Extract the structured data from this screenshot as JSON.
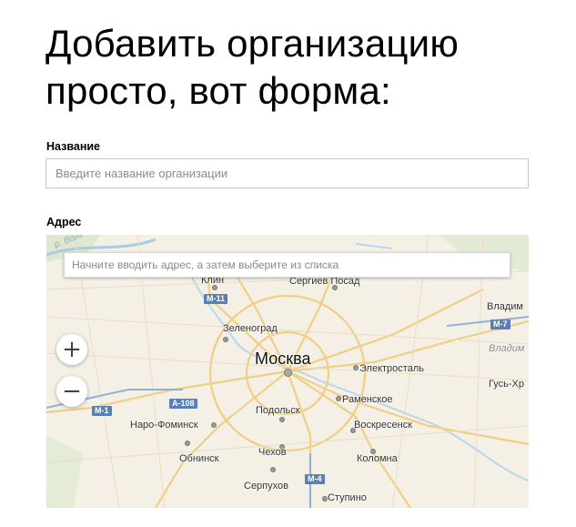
{
  "heading": "Добавить организацию просто, вот форма:",
  "name_field": {
    "label": "Название",
    "placeholder": "Введите название организации"
  },
  "address_field": {
    "label": "Адрес",
    "placeholder": "Начните вводить адрес, а затем выберите из списка"
  },
  "map": {
    "zoom_in": "+",
    "zoom_out": "−",
    "water_label": "р. Волг",
    "cities": {
      "klin": "Клин",
      "sergiev_posad": "Сергиев Посад",
      "vladimir": "Владим",
      "vladimir_region": "Владим",
      "zelenograd": "Зеленоград",
      "moscow": "Москва",
      "elektrostal": "Электросталь",
      "gus": "Гусь-Хр",
      "ramenskoe": "Раменское",
      "podolsk": "Подольск",
      "naro_fominsk": "Наро-Фоминск",
      "voskresensk": "Воскресенск",
      "obninsk": "Обнинск",
      "chekhov": "Чехов",
      "kolomna": "Коломна",
      "serpukhov": "Серпухов",
      "stupino": "Ступино"
    },
    "roads": {
      "m11": "М-11",
      "m7": "М-7",
      "a108": "А-108",
      "m1": "М-1",
      "m4": "М-4"
    }
  }
}
